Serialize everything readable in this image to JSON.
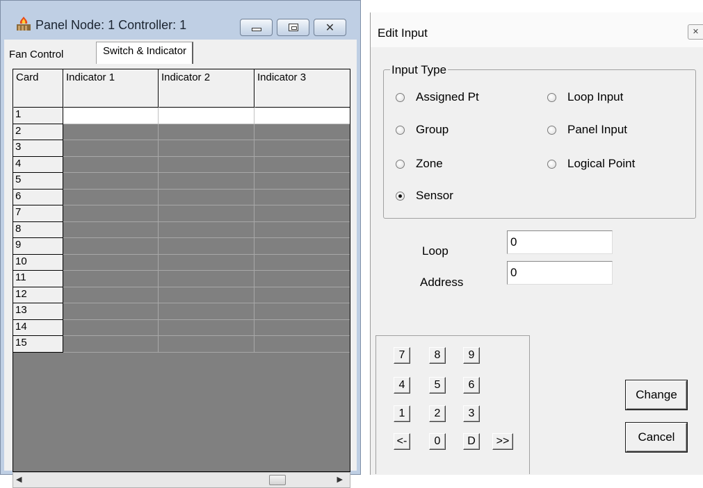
{
  "panel_window": {
    "title": "Panel Node: 1 Controller: 1",
    "tabs": [
      {
        "label": "Fan Control",
        "active": false
      },
      {
        "label": "Switch & Indicator",
        "active": true
      }
    ],
    "grid": {
      "headers": [
        "Card",
        "Indicator 1",
        "Indicator 2",
        "Indicator 3"
      ],
      "rows": [
        "1",
        "2",
        "3",
        "4",
        "5",
        "6",
        "7",
        "8",
        "9",
        "10",
        "11",
        "12",
        "13",
        "14",
        "15"
      ],
      "editable_rows": 1
    }
  },
  "edit_window": {
    "title": "Edit Input",
    "input_type": {
      "label": "Input Type",
      "options": [
        "Assigned Pt",
        "Loop Input",
        "Group",
        "Panel Input",
        "Zone",
        "Logical Point",
        "Sensor"
      ],
      "selected": "Sensor"
    },
    "loop": {
      "label": "Loop",
      "value": "0"
    },
    "address": {
      "label": "Address",
      "value": "0"
    },
    "keypad": [
      "7",
      "8",
      "9",
      "4",
      "5",
      "6",
      "1",
      "2",
      "3",
      "<-",
      "0",
      "D",
      ">>"
    ],
    "change_label": "Change",
    "cancel_label": "Cancel"
  }
}
